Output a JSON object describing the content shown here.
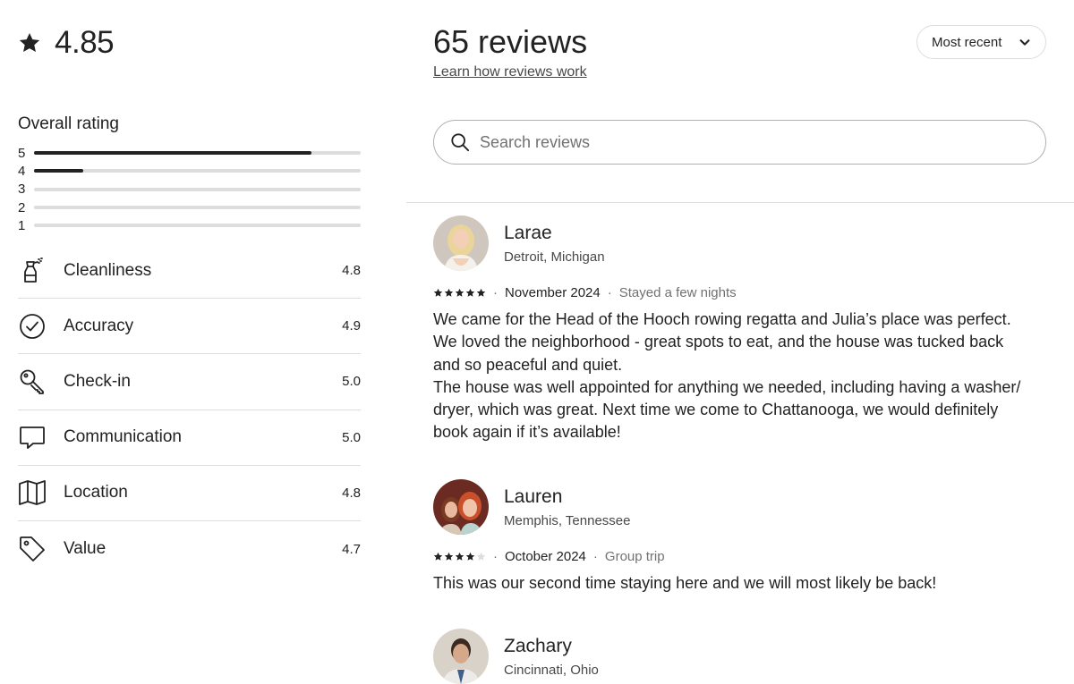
{
  "overall": {
    "score": "4.85",
    "title": "Overall rating",
    "distribution": [
      {
        "label": "5",
        "fraction": 0.85
      },
      {
        "label": "4",
        "fraction": 0.15
      },
      {
        "label": "3",
        "fraction": 0.0
      },
      {
        "label": "2",
        "fraction": 0.0
      },
      {
        "label": "1",
        "fraction": 0.0
      }
    ]
  },
  "categories": [
    {
      "name": "Cleanliness",
      "value": "4.8",
      "icon": "spray-bottle-icon"
    },
    {
      "name": "Accuracy",
      "value": "4.9",
      "icon": "check-circle-icon"
    },
    {
      "name": "Check-in",
      "value": "5.0",
      "icon": "key-icon"
    },
    {
      "name": "Communication",
      "value": "5.0",
      "icon": "chat-bubble-icon"
    },
    {
      "name": "Location",
      "value": "4.8",
      "icon": "map-icon"
    },
    {
      "name": "Value",
      "value": "4.7",
      "icon": "tag-icon"
    }
  ],
  "header": {
    "count": "65 reviews",
    "learn_link": "Learn how reviews work",
    "sort_label": "Most recent"
  },
  "search": {
    "placeholder": "Search reviews"
  },
  "reviews": [
    {
      "name": "Larae",
      "location": "Detroit, Michigan",
      "rating": 5,
      "date": "November 2024",
      "stay": "Stayed a few nights",
      "text_lines": [
        "We came for the Head of the Hooch rowing regatta and Julia’s place was perfect.",
        "We loved the neighborhood - great spots to eat, and the house was tucked back",
        "and so peaceful and quiet.",
        "The house was well appointed for anything we needed, including having a washer/",
        "dryer, which was great. Next time we come to Chattanooga, we would definitely",
        "book again if it’s available!"
      ]
    },
    {
      "name": "Lauren",
      "location": "Memphis, Tennessee",
      "rating": 4,
      "date": "October 2024",
      "stay": "Group trip",
      "text_lines": [
        "This was our second time staying here and we will most likely be back!"
      ]
    },
    {
      "name": "Zachary",
      "location": "Cincinnati, Ohio"
    }
  ],
  "colors": {
    "text": "#222222",
    "secondary": "#717171",
    "border": "#dddddd",
    "bar_fill": "#222222"
  }
}
